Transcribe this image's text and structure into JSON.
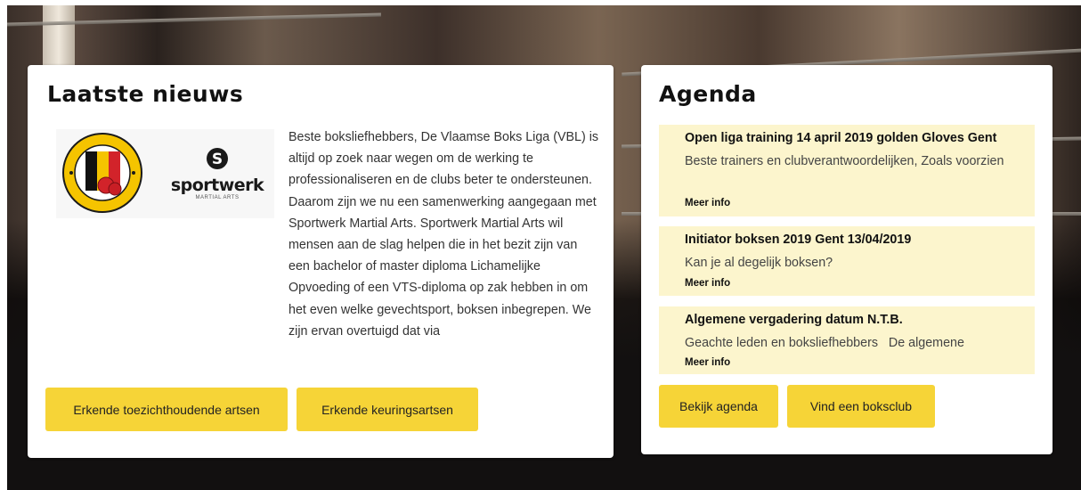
{
  "news": {
    "title": "Laatste nieuws",
    "logos": {
      "vbl_text": "VLAAMSEBOKSLIGA",
      "sportwerk_name": "sportwerk",
      "sportwerk_sub": "MARTIAL ARTS",
      "sportwerk_icon": "S"
    },
    "body": "Beste boksliefhebbers, De Vlaamse Boks Liga (VBL) is altijd op zoek naar wegen om de werking te professionaliseren en de clubs beter te ondersteunen. Daarom zijn we nu een samenwerking aangegaan met Sportwerk Martial Arts. Sportwerk Martial Arts wil mensen aan de slag helpen die in het bezit zijn van een bachelor of master diploma Lichamelijke Opvoeding of een VTS-diploma op zak hebben in om het even welke gevechtsport, boksen inbegrepen. We zijn ervan overtuigd dat via",
    "buttons": {
      "artsen": "Erkende toezichthoudende artsen",
      "keuring": "Erkende keuringsartsen"
    }
  },
  "agenda": {
    "title": "Agenda",
    "items": [
      {
        "title": "Open liga training 14 april 2019 golden Gloves Gent",
        "desc": "Beste trainers en clubverantwoordelijken, Zoals voorzien",
        "more": "Meer info"
      },
      {
        "title": "Initiator boksen 2019 Gent 13/04/2019",
        "desc": "Kan je al degelijk boksen?",
        "more": "Meer info"
      },
      {
        "title": "Algemene vergadering datum N.T.B.",
        "desc": "Geachte leden en boksliefhebbers   De algemene",
        "more": "Meer info"
      }
    ],
    "buttons": {
      "agenda": "Bekijk agenda",
      "club": "Vind een boksclub"
    }
  },
  "colors": {
    "accent": "#f6d437",
    "agenda_item_bg": "#fcf5cd",
    "card_bg": "#ffffff"
  }
}
